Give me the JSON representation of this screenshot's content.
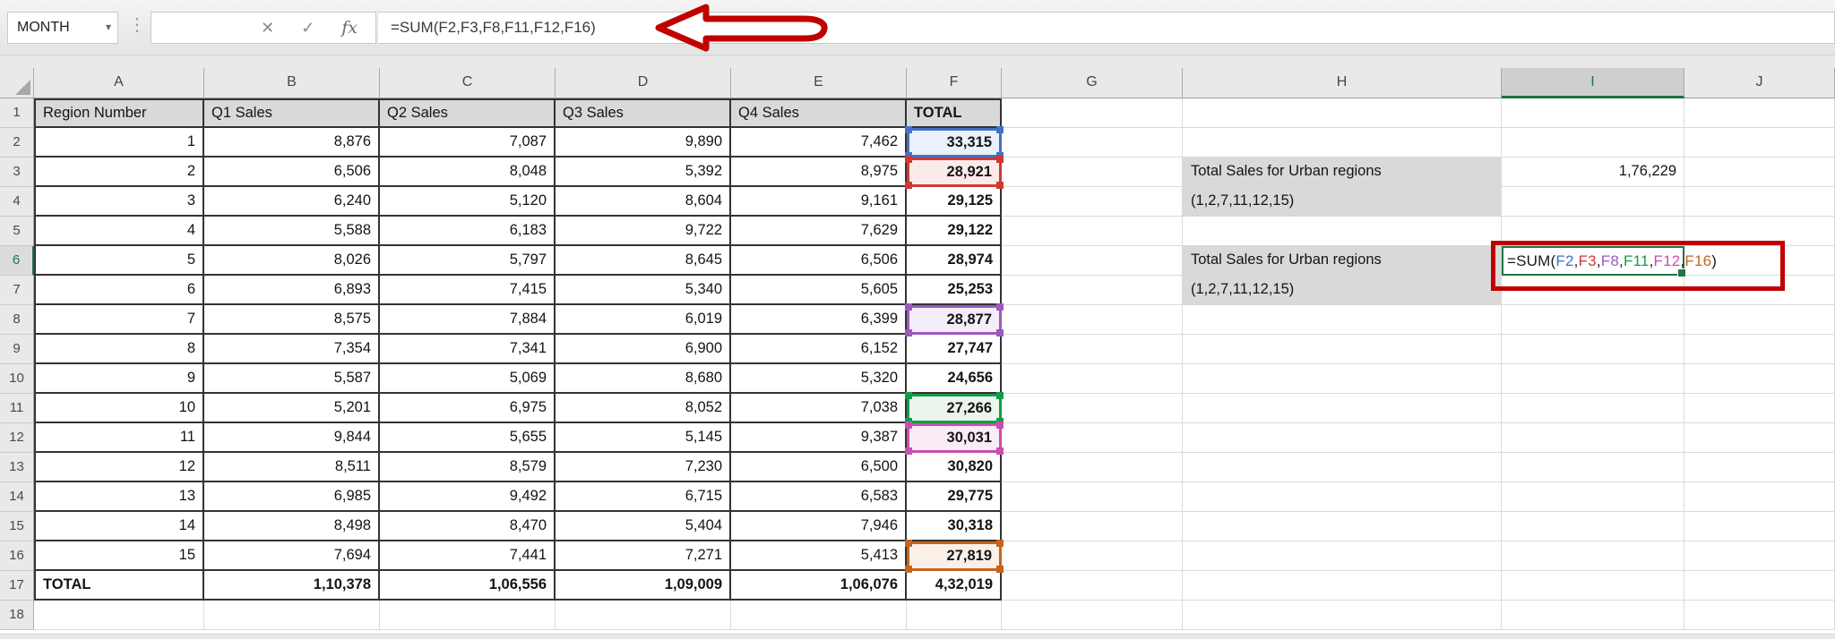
{
  "formula_bar": {
    "name_box": "MONTH",
    "cancel_glyph": "✕",
    "enter_glyph": "✓",
    "fx_glyph": "fx",
    "formula": "=SUM(F2,F3,F8,F11,F12,F16)"
  },
  "sheet": {
    "columns": [
      "A",
      "B",
      "C",
      "D",
      "E",
      "F",
      "G",
      "H",
      "I",
      "J"
    ],
    "selected_column": "I",
    "selected_row": 6,
    "visible_rows": 18
  },
  "table": {
    "headers": [
      "Region Number",
      "Q1 Sales",
      "Q2 Sales",
      "Q3 Sales",
      "Q4 Sales",
      "TOTAL"
    ],
    "rows": [
      [
        "1",
        "8,876",
        "7,087",
        "9,890",
        "7,462",
        "33,315"
      ],
      [
        "2",
        "6,506",
        "8,048",
        "5,392",
        "8,975",
        "28,921"
      ],
      [
        "3",
        "6,240",
        "5,120",
        "8,604",
        "9,161",
        "29,125"
      ],
      [
        "4",
        "5,588",
        "6,183",
        "9,722",
        "7,629",
        "29,122"
      ],
      [
        "5",
        "8,026",
        "5,797",
        "8,645",
        "6,506",
        "28,974"
      ],
      [
        "6",
        "6,893",
        "7,415",
        "5,340",
        "5,605",
        "25,253"
      ],
      [
        "7",
        "8,575",
        "7,884",
        "6,019",
        "6,399",
        "28,877"
      ],
      [
        "8",
        "7,354",
        "7,341",
        "6,900",
        "6,152",
        "27,747"
      ],
      [
        "9",
        "5,587",
        "5,069",
        "8,680",
        "5,320",
        "24,656"
      ],
      [
        "10",
        "5,201",
        "6,975",
        "8,052",
        "7,038",
        "27,266"
      ],
      [
        "11",
        "9,844",
        "5,655",
        "5,145",
        "9,387",
        "30,031"
      ],
      [
        "12",
        "8,511",
        "8,579",
        "7,230",
        "6,500",
        "30,820"
      ],
      [
        "13",
        "6,985",
        "9,492",
        "6,715",
        "6,583",
        "29,775"
      ],
      [
        "14",
        "8,498",
        "8,470",
        "5,404",
        "7,946",
        "30,318"
      ],
      [
        "15",
        "7,694",
        "7,441",
        "7,271",
        "5,413",
        "27,819"
      ]
    ],
    "total_row": [
      "TOTAL",
      "1,10,378",
      "1,06,556",
      "1,09,009",
      "1,06,076",
      "4,32,019"
    ]
  },
  "references": [
    {
      "ref": "F2",
      "row": 2,
      "color": "#4472C4",
      "fill": "#EAF1FB"
    },
    {
      "ref": "F3",
      "row": 3,
      "color": "#CC3A33",
      "fill": "#FAEBEA"
    },
    {
      "ref": "F8",
      "row": 8,
      "color": "#9B59C0",
      "fill": "#F4EDFA"
    },
    {
      "ref": "F11",
      "row": 11,
      "color": "#129C49",
      "fill": "#EBF5EE"
    },
    {
      "ref": "F12",
      "row": 12,
      "color": "#C94FB2",
      "fill": "#FAECF6"
    },
    {
      "ref": "F16",
      "row": 16,
      "color": "#C4641D",
      "fill": "#FBF0E7"
    }
  ],
  "side": {
    "h_labels": {
      "3": "Total Sales for Urban regions",
      "4": "(1,2,7,11,12,15)",
      "6": "Total Sales for Urban regions",
      "7": "(1,2,7,11,12,15)"
    },
    "i_value_row": 3,
    "i_value": "1,76,229",
    "formula_row": 6,
    "formula_parts": [
      {
        "text": "=SUM(",
        "color": "#1a1a1a"
      },
      {
        "text": "F2",
        "color": "#4472C4"
      },
      {
        "text": ",",
        "color": "#1a1a1a"
      },
      {
        "text": "F3",
        "color": "#CC3A33"
      },
      {
        "text": ",",
        "color": "#1a1a1a"
      },
      {
        "text": "F8",
        "color": "#9B59C0"
      },
      {
        "text": ",",
        "color": "#1a1a1a"
      },
      {
        "text": "F11",
        "color": "#129C49"
      },
      {
        "text": ",",
        "color": "#1a1a1a"
      },
      {
        "text": "F12",
        "color": "#C94FB2"
      },
      {
        "text": ",",
        "color": "#1a1a1a"
      },
      {
        "text": "F16",
        "color": "#C4641D"
      },
      {
        "text": ")",
        "color": "#1a1a1a"
      }
    ]
  },
  "colors": {
    "active_cell_green": "#217346",
    "annotation_red": "#C00000",
    "header_fill": "#D9D9D9",
    "table_border": "#333333"
  }
}
